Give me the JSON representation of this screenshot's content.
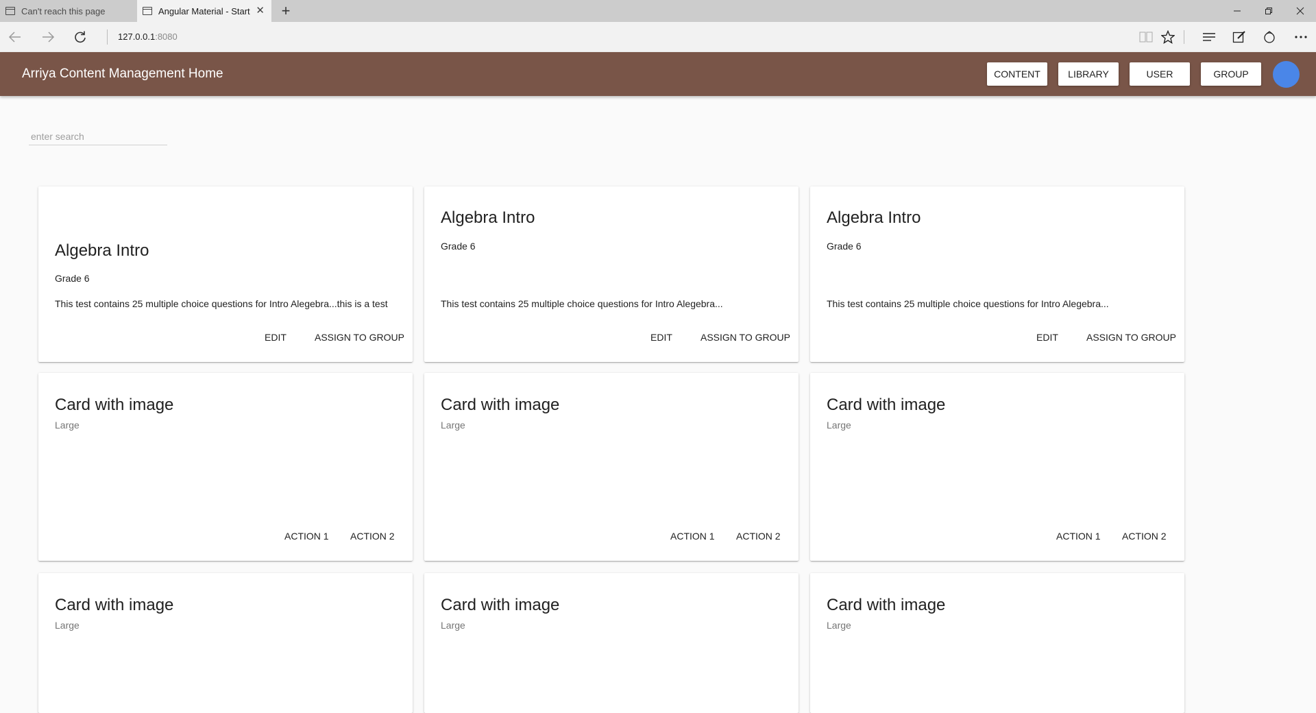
{
  "browser": {
    "tabs": [
      {
        "label": "Can't reach this page",
        "active": false
      },
      {
        "label": "Angular Material - Start",
        "active": true
      }
    ],
    "new_tab_glyph": "+",
    "url_host": "127.0.0.1",
    "url_port": ":8080"
  },
  "app": {
    "title": "Arriya Content Management Home",
    "nav": [
      "CONTENT",
      "LIBRARY",
      "USER",
      "GROUP"
    ],
    "accent_color": "#795548",
    "avatar_color": "#4a86e8"
  },
  "search": {
    "placeholder": "enter search"
  },
  "cards_row1": [
    {
      "title": "Algebra Intro",
      "subtitle": "Grade 6",
      "description": "This test contains 25 multiple choice questions for Intro Alegebra...this is a test",
      "actions": [
        "EDIT",
        "ASSIGN TO GROUP"
      ]
    },
    {
      "title": "Algebra Intro",
      "subtitle": "Grade 6",
      "description": "This test contains 25 multiple choice questions for Intro Alegebra...",
      "actions": [
        "EDIT",
        "ASSIGN TO GROUP"
      ]
    },
    {
      "title": "Algebra Intro",
      "subtitle": "Grade 6",
      "description": "This test contains 25 multiple choice questions for Intro Alegebra...",
      "actions": [
        "EDIT",
        "ASSIGN TO GROUP"
      ]
    }
  ],
  "cards_row2": [
    {
      "title": "Card with image",
      "subtitle": "Large",
      "actions": [
        "ACTION 1",
        "ACTION 2"
      ]
    },
    {
      "title": "Card with image",
      "subtitle": "Large",
      "actions": [
        "ACTION 1",
        "ACTION 2"
      ]
    },
    {
      "title": "Card with image",
      "subtitle": "Large",
      "actions": [
        "ACTION 1",
        "ACTION 2"
      ]
    }
  ],
  "cards_row3": [
    {
      "title": "Card with image",
      "subtitle": "Large"
    },
    {
      "title": "Card with image",
      "subtitle": "Large"
    },
    {
      "title": "Card with image",
      "subtitle": "Large"
    }
  ]
}
